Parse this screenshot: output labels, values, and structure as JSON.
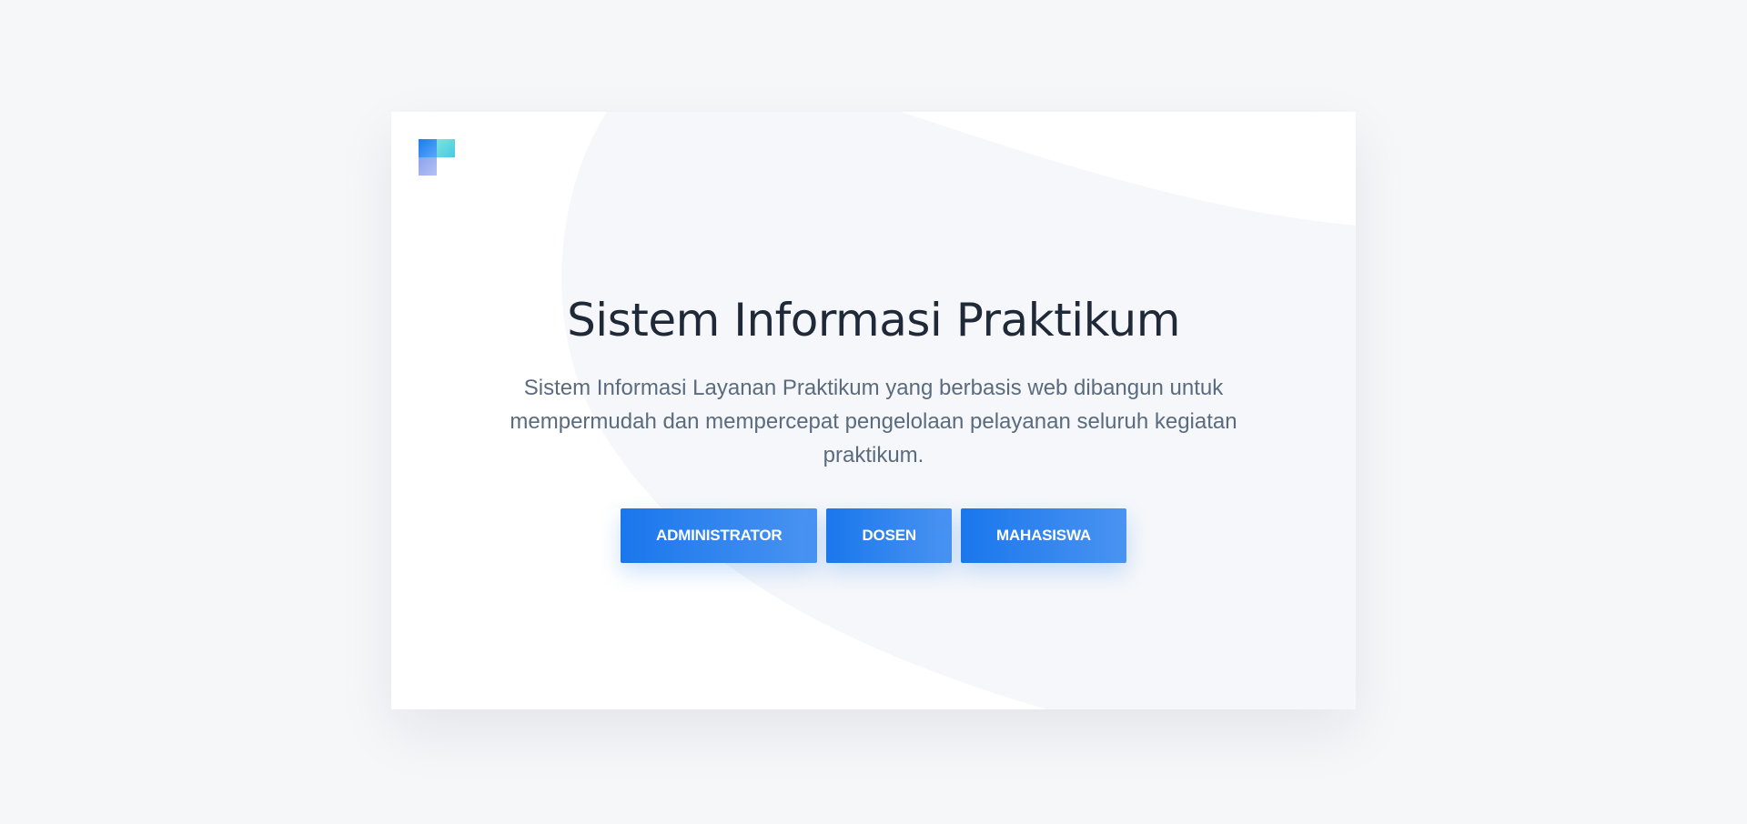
{
  "hero": {
    "title": "Sistem Informasi Praktikum",
    "description": "Sistem Informasi Layanan Praktikum yang berbasis web dibangun untuk mempermudah dan mempercepat pengelolaan pelayanan seluruh kegiatan praktikum."
  },
  "buttons": {
    "administrator": "ADMINISTRATOR",
    "dosen": "DOSEN",
    "mahasiswa": "MAHASISWA"
  },
  "colors": {
    "background": "#f6f7f9",
    "card": "#ffffff",
    "title": "#1f2937",
    "text": "#5b6b7e",
    "accent_start": "#1a77ec",
    "accent_end": "#4a93f2"
  },
  "logo": {
    "icon": "app-logo-icon"
  }
}
